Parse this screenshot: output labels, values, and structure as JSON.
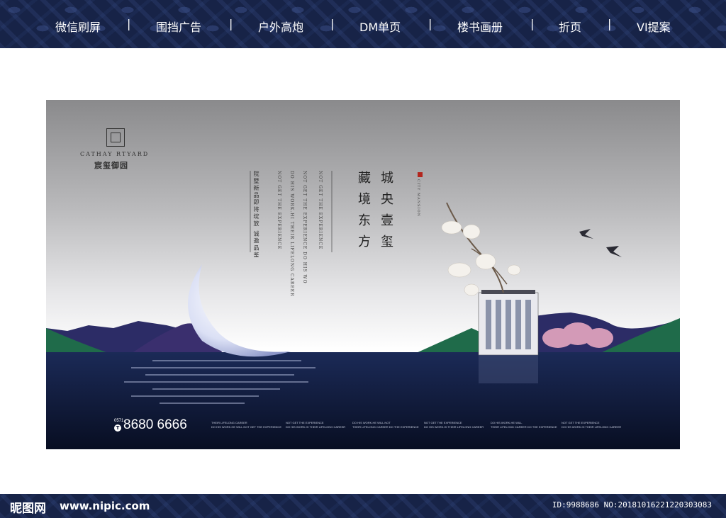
{
  "nav": {
    "items": [
      "微信刷屏",
      "围挡广告",
      "户外高炮",
      "DM单页",
      "楼书画册",
      "折页",
      "VI提案"
    ],
    "separator": "|"
  },
  "poster": {
    "brand_en": "CATHAY RTYARD",
    "brand_cn": "宸玺御园",
    "headline_right": "城央壹玺",
    "headline_left": "藏境东方",
    "vertical_small_1": "院墅新品即将绽放 诚邀品鉴",
    "vertical_en_1": "NOT GET THE EXPERIENCE",
    "vertical_en_2": "DO HIS WORK.HI THEIR LIFELONG CAREER",
    "vertical_en_3": "NOT GET THE EXPERIENCE DO HIS WO",
    "vertical_en_4": "NOT GET THE EXPERIENCE",
    "seal_note": "CITY MANSION",
    "area_code": "0571",
    "tel_glyph": "T",
    "phone": "8680 6666",
    "footer_cols": [
      [
        "THEIR LIFELONG CAREER",
        "DO HIS WORK.HE WILL NOT GET THE EXPERIENCE"
      ],
      [
        "NOT GET THE EXPERIENCE",
        "DO HIS WORK.HI THEIR LIFELONG CAREER"
      ],
      [
        "DO HIS WORK.HE WILL NOT",
        "THEIR LIFELONG CAREER DO THE EXPERIENCE"
      ],
      [
        "NOT GET THE EXPERIENCE",
        "DO HIS WORK.HI THEIR LIFELONG CAREER"
      ],
      [
        "DO HIS WORK.HE WILL",
        "THEIR LIFELONG CAREER DO THE EXPERIENCE"
      ],
      [
        "NOT GET THE EXPERIENCE",
        "DO HIS WORK.HI THEIR LIFELONG CAREER"
      ]
    ]
  },
  "footer": {
    "logo": "昵图网",
    "url": "www.nipic.com",
    "id_text": "ID:9988686 NO:20181016221220303083"
  },
  "colors": {
    "nav_bg": "#172347",
    "water": "#0d1633",
    "hills": "#2c2c66",
    "hill_green": "#1f6b4a",
    "blossom": "#e6a7c0"
  }
}
